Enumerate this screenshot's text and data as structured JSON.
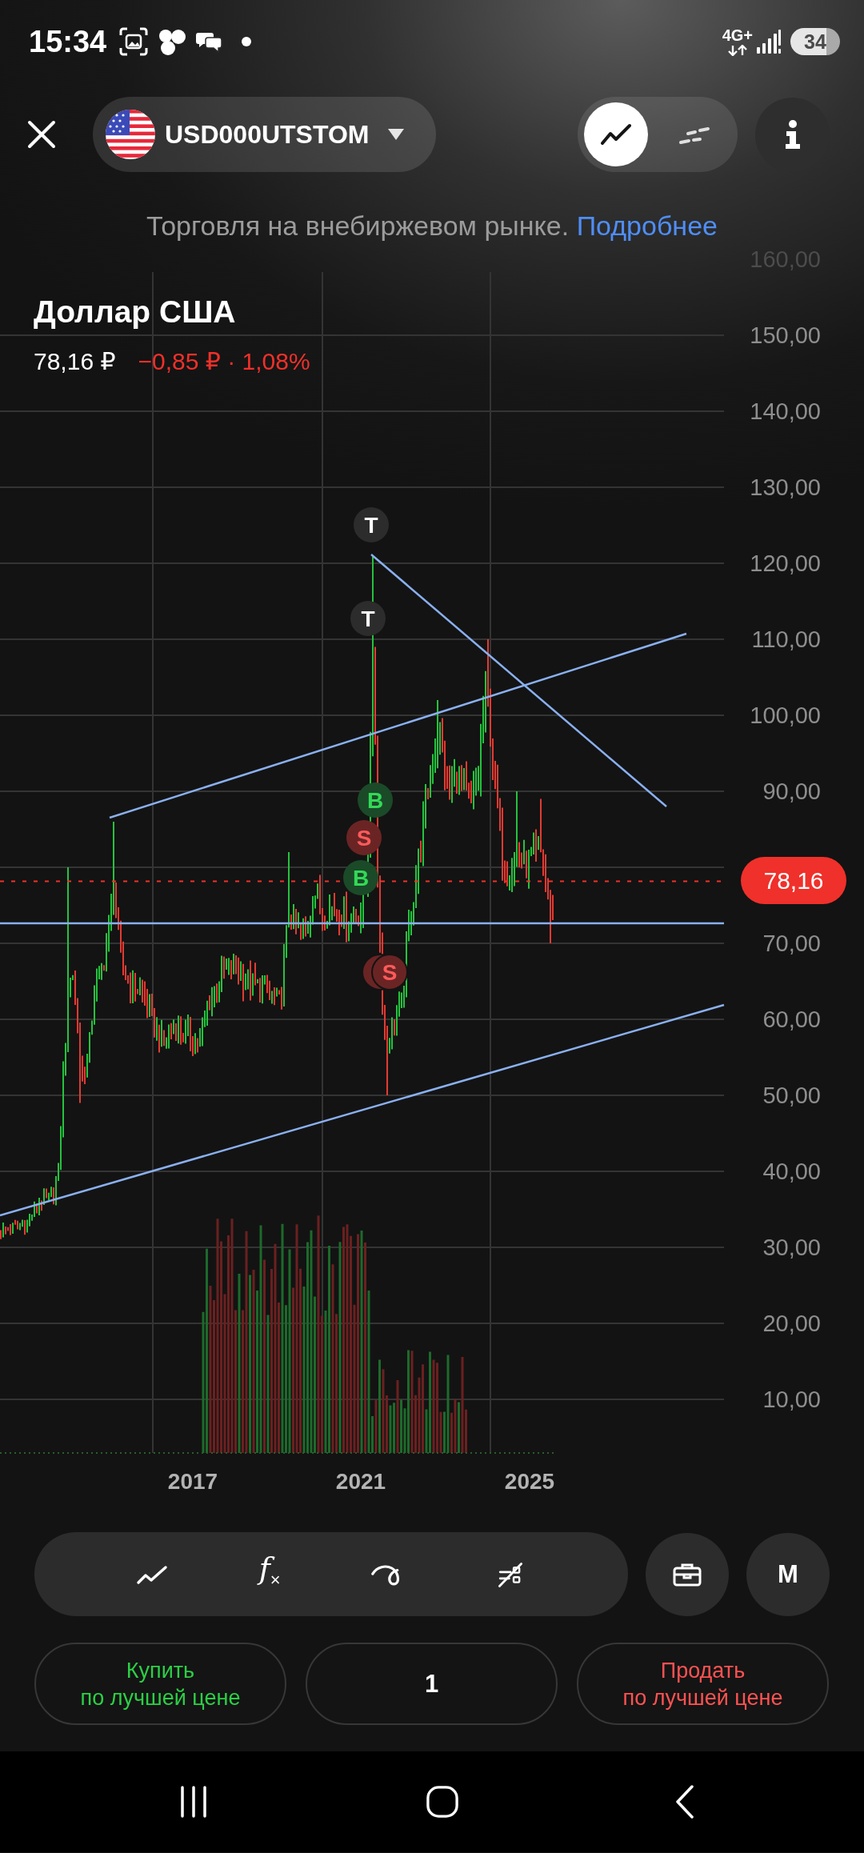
{
  "status_bar": {
    "time": "15:34",
    "network": "4G+",
    "battery": "34"
  },
  "header": {
    "symbol": "USD000UTSTOM",
    "chart_modes": [
      {
        "kind": "line",
        "selected": true
      },
      {
        "kind": "dashed",
        "selected": false
      }
    ]
  },
  "notice": {
    "text": "Торговля на внебиржевом рынке.",
    "link": "Подробнее"
  },
  "instrument": {
    "name": "Доллар США",
    "price": "78,16 ₽",
    "change": "−0,85 ₽ · 1,08%",
    "negative": true
  },
  "chart": {
    "price_labels": [
      "160,00",
      "150,00",
      "140,00",
      "130,00",
      "120,00",
      "110,00",
      "100,00",
      "90,00",
      "70,00",
      "60,00",
      "50,00",
      "40,00",
      "30,00",
      "20,00",
      "10,00"
    ],
    "current_price": "78,16",
    "year_labels": [
      "2017",
      "2021",
      "2025"
    ],
    "markers": [
      {
        "kind": "trade",
        "label": "T",
        "stacked": false
      },
      {
        "kind": "trade",
        "label": "T",
        "stacked": false
      },
      {
        "kind": "buy",
        "label": "B",
        "stacked": false
      },
      {
        "kind": "sell",
        "label": "S",
        "stacked": false
      },
      {
        "kind": "buy",
        "label": "B",
        "stacked": false
      },
      {
        "kind": "sell",
        "label": "S",
        "stacked": true
      }
    ]
  },
  "toolbar": {
    "tools": [
      {
        "kind": "chart"
      },
      {
        "kind": "indicators",
        "glyph": "f$_{×}$"
      },
      {
        "kind": "drawing"
      },
      {
        "kind": "hide_drawings"
      }
    ],
    "mode_label": "M"
  },
  "trade": {
    "buy": {
      "title": "Купить",
      "subtitle": "по лучшей цене"
    },
    "quantity": "1",
    "sell": {
      "title": "Продать",
      "subtitle": "по лучшей цене"
    }
  }
}
